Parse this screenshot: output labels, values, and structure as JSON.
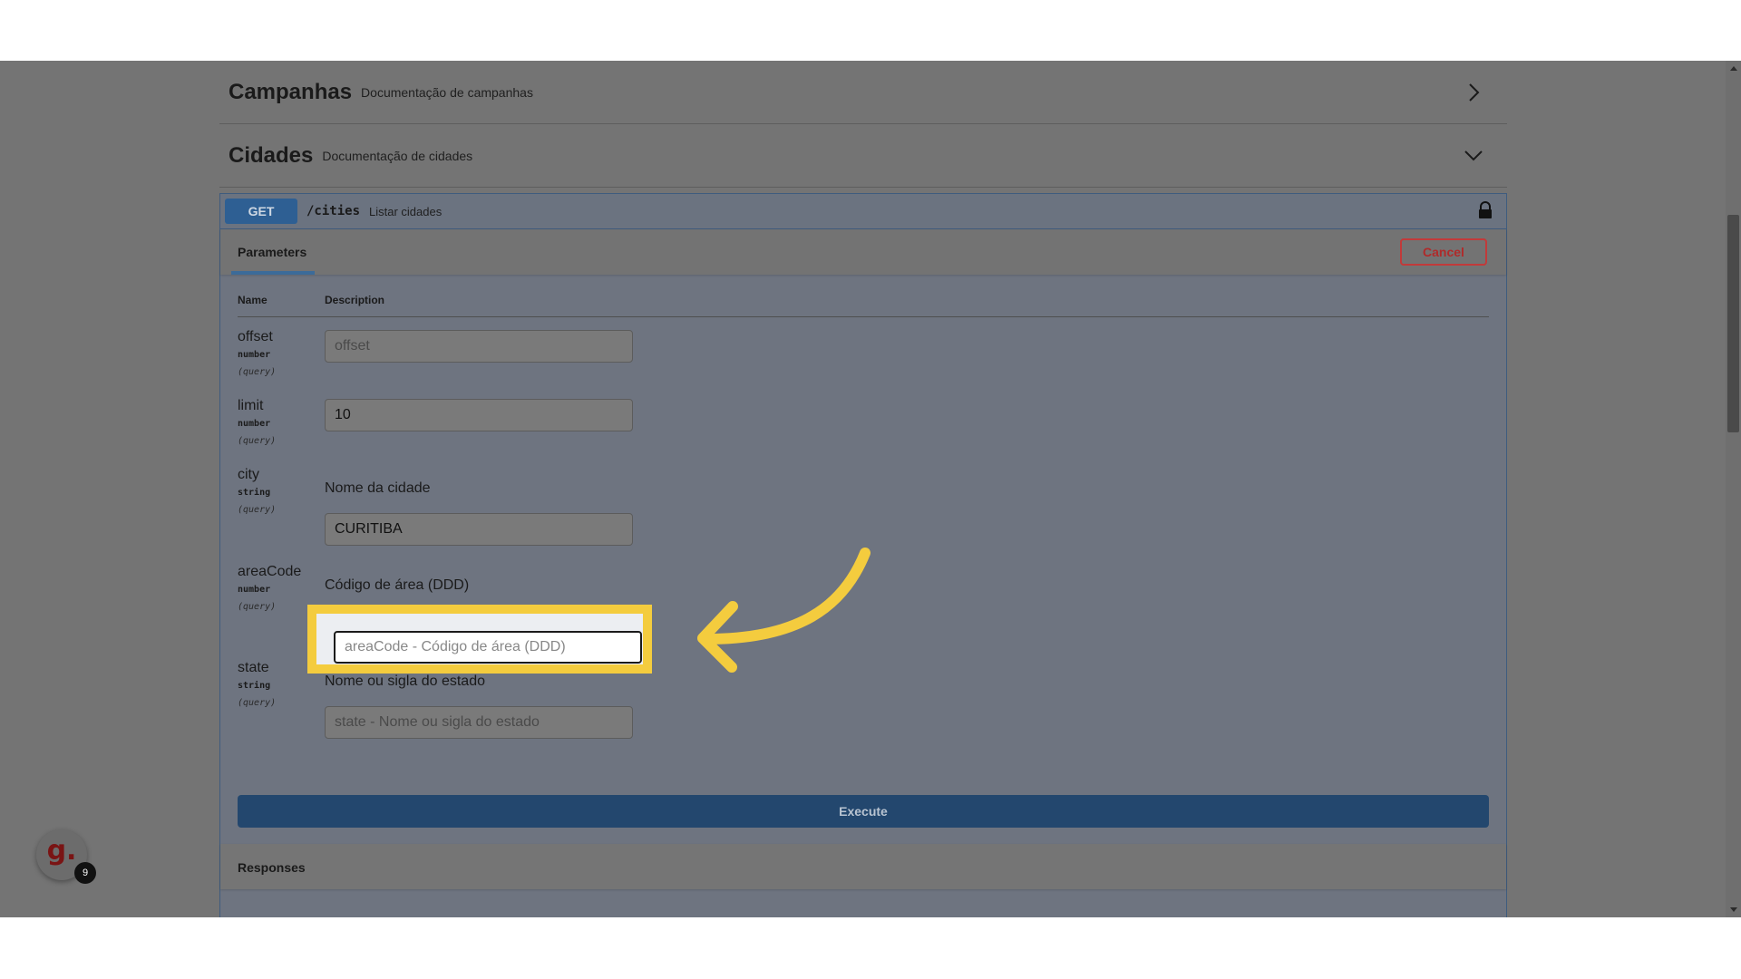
{
  "tags": [
    {
      "name": "Campanhas",
      "description": "Documentação de campanhas",
      "state": "collapsed"
    },
    {
      "name": "Cidades",
      "description": "Documentação de cidades",
      "state": "expanded"
    }
  ],
  "operation": {
    "method": "GET",
    "path": "/cities",
    "summary": "Listar cidades",
    "tab_label": "Parameters",
    "cancel_label": "Cancel",
    "columns": {
      "name": "Name",
      "description": "Description"
    },
    "params": [
      {
        "name": "offset",
        "type": "number",
        "in": "(query)",
        "description": "",
        "value": "",
        "placeholder": "offset"
      },
      {
        "name": "limit",
        "type": "number",
        "in": "(query)",
        "description": "",
        "value": "10",
        "placeholder": ""
      },
      {
        "name": "city",
        "type": "string",
        "in": "(query)",
        "description": "Nome da cidade",
        "value": "CURITIBA",
        "placeholder": ""
      },
      {
        "name": "areaCode",
        "type": "number",
        "in": "(query)",
        "description": "Código de área (DDD)",
        "value": "",
        "placeholder": "areaCode - Código de área (DDD)"
      },
      {
        "name": "state",
        "type": "string",
        "in": "(query)",
        "description": "Nome ou sigla do estado",
        "value": "",
        "placeholder": "state - Nome ou sigla do estado"
      }
    ],
    "execute_label": "Execute",
    "responses_label": "Responses"
  },
  "widget": {
    "logo": "g.",
    "badge": "9"
  },
  "colors": {
    "get": "#2e5f93",
    "cancel": "#c23a3a",
    "highlight": "#f4cc3e",
    "arrow": "#f4cc3e"
  },
  "icons": [
    "chevron-right-icon",
    "chevron-down-icon",
    "lock-icon",
    "curved-arrow-icon"
  ]
}
